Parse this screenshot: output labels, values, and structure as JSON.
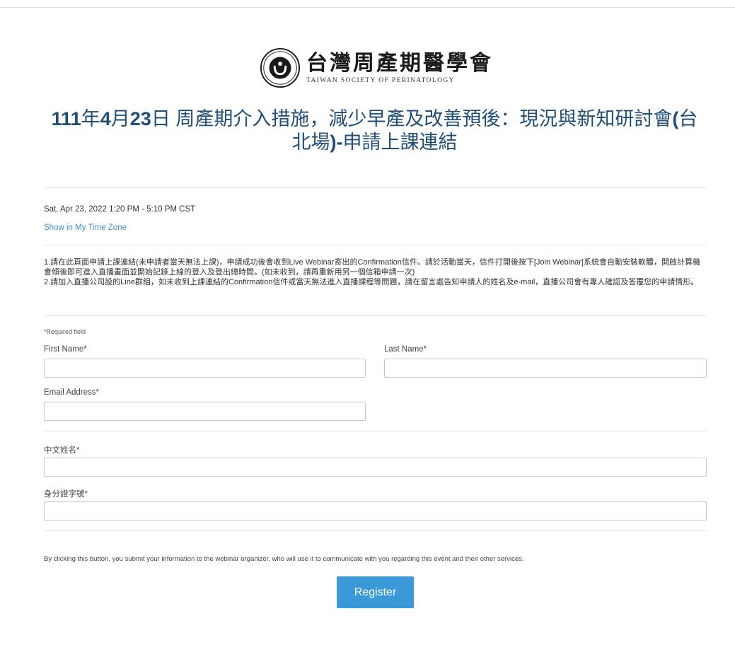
{
  "org": {
    "name_cn": "台灣周產期醫學會",
    "name_en": "TAIWAN SOCIETY OF PERINATOLOGY"
  },
  "event": {
    "title_parts": [
      {
        "text": "111",
        "bold": true
      },
      {
        "text": "年",
        "bold": false
      },
      {
        "text": "4",
        "bold": true
      },
      {
        "text": "月",
        "bold": false
      },
      {
        "text": "23",
        "bold": true
      },
      {
        "text": "日 周產期介入措施，減少早產及改善預後：現況與新知研討會",
        "bold": false
      },
      {
        "text": "(",
        "bold": true
      },
      {
        "text": "台北場",
        "bold": false
      },
      {
        "text": ")-",
        "bold": true
      },
      {
        "text": "申請上課連結",
        "bold": false
      }
    ],
    "datetime": "Sat, Apr 23, 2022 1:20 PM - 5:10 PM CST",
    "timezone_link": "Show in My Time Zone",
    "description_lines": [
      "1.請在此頁面申請上課連結(未申請者當天無法上課)，申請成功後會收到Live Webinar寄出的Confirmation信件。請於活動當天，信件打開後按下[Join Webinar]系統會自動安裝軟體，開啟計算機會傾後即可進入直播畫面並開始記錄上線的登入及登出總時間。(如未收到，請再重新用另一個信箱申請一次)",
      "2.請加入直播公司設的Line群組，如未收到上課連結的Confirmation信件或當天無法進入直播課程等問題，請在留言處告知申請人的姓名及e-mail，直播公司會有專人確認及答覆您的申請情形。"
    ]
  },
  "form": {
    "required_note": "*Required field",
    "first_name_label": "First Name*",
    "first_name_value": "",
    "last_name_label": "Last Name*",
    "last_name_value": "",
    "email_label": "Email Address*",
    "email_value": "",
    "chinese_name_label": "中文姓名*",
    "chinese_name_value": "",
    "id_number_label": "身分證字號*",
    "id_number_value": "",
    "consent_text": "By clicking this button, you submit your information to the webinar organizer, who will use it to communicate with you regarding this event and their other services.",
    "register_label": "Register"
  },
  "colors": {
    "title": "#1f4e79",
    "link": "#3b8fd3",
    "button": "#3a9ad9"
  }
}
